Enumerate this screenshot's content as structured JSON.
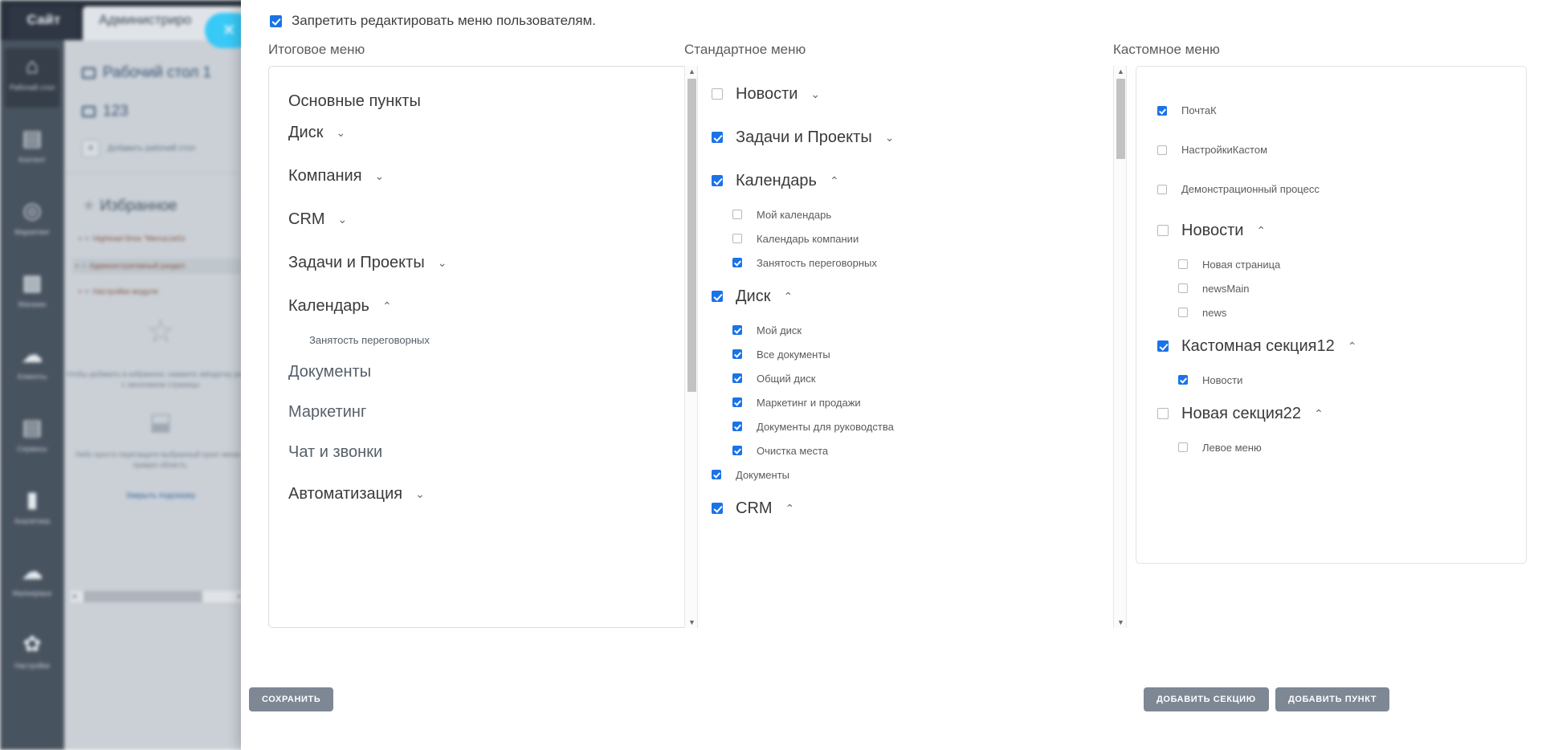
{
  "background": {
    "tabs": {
      "site": "Сайт",
      "admin": "Администриро"
    },
    "close_icon": "✕",
    "nav": [
      {
        "icon": "⌂",
        "label": "Рабочий стол",
        "active": true
      },
      {
        "icon": "▤",
        "label": "Контент",
        "active": false
      },
      {
        "icon": "◎",
        "label": "Маркетинг",
        "active": false
      },
      {
        "icon": "▩",
        "label": "Магазин",
        "active": false
      },
      {
        "icon": "☁",
        "label": "Клиенты",
        "active": false
      },
      {
        "icon": "▤",
        "label": "Сервисы",
        "active": false
      },
      {
        "icon": "▮",
        "label": "Аналитика",
        "active": false
      },
      {
        "icon": "☁",
        "label": "Marketplace",
        "active": false
      },
      {
        "icon": "✿",
        "label": "Настройки",
        "active": false
      }
    ],
    "workspaces": [
      {
        "label": "Рабочий стол 1"
      },
      {
        "label": "123"
      }
    ],
    "add_workspace": "Добавить рабочий стол",
    "favorites_title": "Избранное",
    "favorites": [
      {
        "label": "Highload-блок \"MenuListGr"
      },
      {
        "label": "Административный раздел"
      },
      {
        "label": "Настройки модуля"
      }
    ],
    "hint_text": "Чтобы добавить в избранное, нажмите звёздочку рядом с заголовком страницы",
    "hint_text2": "Либо просто перетащите выбранный пункт меню в правую область.",
    "hint_link": "Закрыть подсказку"
  },
  "modal": {
    "top_checkbox": {
      "label": "Запретить редактировать меню пользователям.",
      "checked": true
    },
    "columns": {
      "result": {
        "header": "Итоговое меню"
      },
      "standard": {
        "header": "Стандартное меню"
      },
      "custom": {
        "header": "Кастомное меню"
      }
    },
    "result_menu": {
      "group_title": "Основные пункты",
      "items": [
        {
          "label": "Диск",
          "chevron": "⌄",
          "level": 0,
          "dim": false
        },
        {
          "label": "Компания",
          "chevron": "⌄",
          "level": 0,
          "dim": false
        },
        {
          "label": "CRM",
          "chevron": "⌄",
          "level": 0,
          "dim": false
        },
        {
          "label": "Задачи и Проекты",
          "chevron": "⌄",
          "level": 0,
          "dim": false
        },
        {
          "label": "Календарь",
          "chevron": "⌃",
          "level": 0,
          "dim": false
        },
        {
          "label": "Занятость переговорных",
          "chevron": "",
          "level": 1,
          "dim": true
        },
        {
          "label": "Документы",
          "chevron": "",
          "level": 0,
          "dim": true
        },
        {
          "label": "Маркетинг",
          "chevron": "",
          "level": 0,
          "dim": true
        },
        {
          "label": "Чат и звонки",
          "chevron": "",
          "level": 0,
          "dim": true
        },
        {
          "label": "Автоматизация",
          "chevron": "⌄",
          "level": 0,
          "dim": false
        }
      ]
    },
    "standard_menu": {
      "items": [
        {
          "label": "Новости",
          "checked": false,
          "chevron": "⌄",
          "level": 0
        },
        {
          "label": "Задачи и Проекты",
          "checked": true,
          "chevron": "⌄",
          "level": 0
        },
        {
          "label": "Календарь",
          "checked": true,
          "chevron": "⌃",
          "level": 0
        },
        {
          "label": "Мой календарь",
          "checked": false,
          "chevron": "",
          "level": 1
        },
        {
          "label": "Календарь компании",
          "checked": false,
          "chevron": "",
          "level": 1
        },
        {
          "label": "Занятость переговорных",
          "checked": true,
          "chevron": "",
          "level": 1
        },
        {
          "label": "Диск",
          "checked": true,
          "chevron": "⌃",
          "level": 0
        },
        {
          "label": "Мой диск",
          "checked": true,
          "chevron": "",
          "level": 1
        },
        {
          "label": "Все документы",
          "checked": true,
          "chevron": "",
          "level": 1
        },
        {
          "label": "Общий диск",
          "checked": true,
          "chevron": "",
          "level": 1
        },
        {
          "label": "Маркетинг и продажи",
          "checked": true,
          "chevron": "",
          "level": 1
        },
        {
          "label": "Документы для руководства",
          "checked": true,
          "chevron": "",
          "level": 1
        },
        {
          "label": "Очистка места",
          "checked": true,
          "chevron": "",
          "level": 1
        },
        {
          "label": "Документы",
          "checked": true,
          "chevron": "",
          "level": 0,
          "small": true
        },
        {
          "label": "CRM",
          "checked": true,
          "chevron": "⌃",
          "level": 0
        }
      ]
    },
    "custom_menu": {
      "items": [
        {
          "label": "ПочтаК",
          "checked": true,
          "chevron": "",
          "level": 0,
          "small": true
        },
        {
          "label": "НастройкиКастом",
          "checked": false,
          "chevron": "",
          "level": 0,
          "small": true
        },
        {
          "label": "Демонстрационный процесс",
          "checked": false,
          "chevron": "",
          "level": 0,
          "small": true
        },
        {
          "label": "Новости",
          "checked": false,
          "chevron": "⌃",
          "level": 0
        },
        {
          "label": "Новая страница",
          "checked": false,
          "chevron": "",
          "level": 1
        },
        {
          "label": "newsMain",
          "checked": false,
          "chevron": "",
          "level": 1
        },
        {
          "label": "news",
          "checked": false,
          "chevron": "",
          "level": 1
        },
        {
          "label": "Кастомная секция12",
          "checked": true,
          "chevron": "⌃",
          "level": 0
        },
        {
          "label": "Новости",
          "checked": true,
          "chevron": "",
          "level": 1
        },
        {
          "label": "Новая секция22",
          "checked": false,
          "chevron": "⌃",
          "level": 0
        },
        {
          "label": "Левое меню",
          "checked": false,
          "chevron": "",
          "level": 1
        }
      ]
    },
    "buttons": {
      "save": "Сохранить",
      "add_section": "Добавить секцию",
      "add_item": "Добавить пункт"
    },
    "colors": {
      "checkbox_accent": "#1a73e8",
      "button_bg": "#7e8794",
      "modal_bg": "#ffffff"
    }
  }
}
